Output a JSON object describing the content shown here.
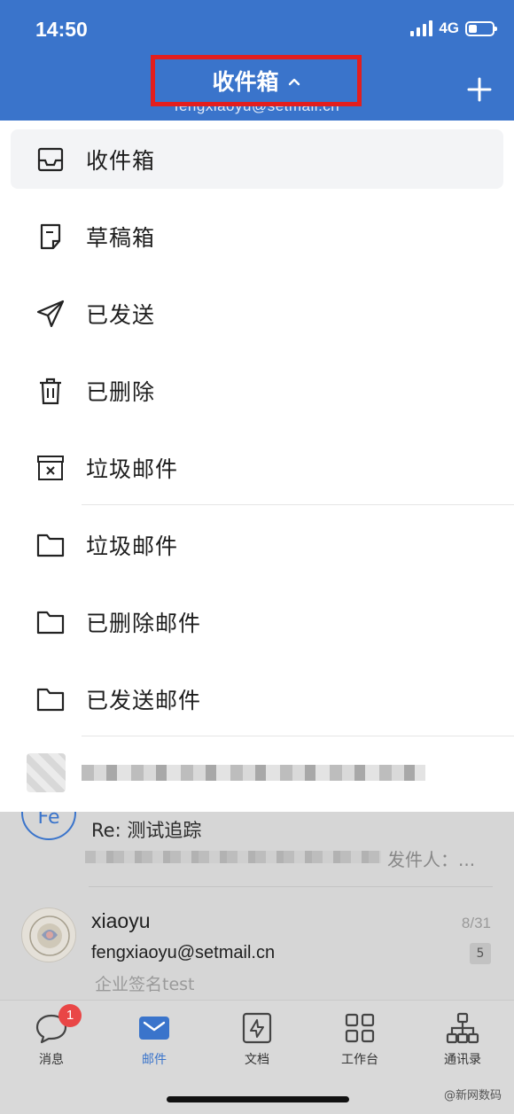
{
  "status_bar": {
    "time": "14:50",
    "network": "4G"
  },
  "header": {
    "title": "收件箱",
    "account_email": "fengxiaoyu@setmail.cn",
    "add_button_label": "+"
  },
  "menu": {
    "items": [
      {
        "label": "收件箱",
        "icon": "inbox-icon",
        "active": true
      },
      {
        "label": "草稿箱",
        "icon": "draft-icon"
      },
      {
        "label": "已发送",
        "icon": "sent-icon"
      },
      {
        "label": "已删除",
        "icon": "trash-icon"
      },
      {
        "label": "垃圾邮件",
        "icon": "spam-icon"
      },
      {
        "label": "垃圾邮件",
        "icon": "folder-icon"
      },
      {
        "label": "已删除邮件",
        "icon": "folder-icon"
      },
      {
        "label": "已发送邮件",
        "icon": "folder-icon"
      }
    ]
  },
  "mail_list": {
    "items": [
      {
        "avatar_text": "Fe",
        "subject": "Re: 测试追踪",
        "from_label": "发件人：..."
      },
      {
        "name": "xiaoyu",
        "date": "8/31",
        "email": "fengxiaoyu@setmail.cn",
        "count": "5",
        "snippet": "企业签名test"
      }
    ]
  },
  "tabbar": {
    "tabs": [
      {
        "label": "消息",
        "icon": "chat-icon",
        "badge": "1"
      },
      {
        "label": "邮件",
        "icon": "mail-icon",
        "active": true
      },
      {
        "label": "文档",
        "icon": "document-icon"
      },
      {
        "label": "工作台",
        "icon": "grid-icon"
      },
      {
        "label": "通讯录",
        "icon": "org-chart-icon"
      }
    ]
  },
  "watermark": "@新网数码",
  "colors": {
    "brand": "#3a74cb",
    "highlight": "#e31e1e",
    "badge": "#e94646"
  }
}
